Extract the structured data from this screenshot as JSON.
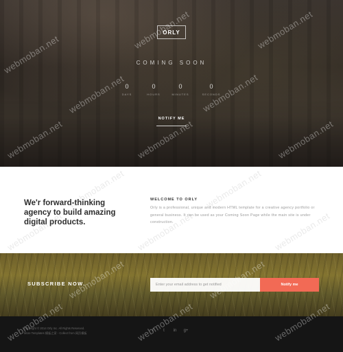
{
  "hero": {
    "logo": "ORLY",
    "heading": "COMING SOON",
    "countdown": [
      {
        "value": "0",
        "unit": "DAYS"
      },
      {
        "value": "0",
        "unit": "HOURS"
      },
      {
        "value": "0",
        "unit": "MINUTES"
      },
      {
        "value": "0",
        "unit": "SECONDS"
      }
    ],
    "notify_label": "NOTIFY ME"
  },
  "about": {
    "tagline": "We'r forward-thinking agency to build amazing digital products.",
    "welcome_title": "WELCOME TO ORLY",
    "welcome_text": "Orly is a professional, unique and modern HTML template for a creative agency portfolio or general business. It can be used as your Coming Soon Page while the main site is under construction."
  },
  "subscribe": {
    "title": "SUBSCRIBE NOW.",
    "email_placeholder": "Enter your email address to get notified",
    "button_label": "Notify me"
  },
  "footer": {
    "copyright": "Copyright © 2014 Orly Inc. All Rights Reserved.",
    "credit": "More Templates 模板之家 - Collect from 网页模板",
    "socials": [
      {
        "icon": "facebook-icon",
        "glyph": "f"
      },
      {
        "icon": "twitter-icon",
        "glyph": "t"
      },
      {
        "icon": "linkedin-icon",
        "glyph": "in"
      },
      {
        "icon": "google-plus-icon",
        "glyph": "g+"
      }
    ]
  },
  "watermark": "webmoban.net"
}
